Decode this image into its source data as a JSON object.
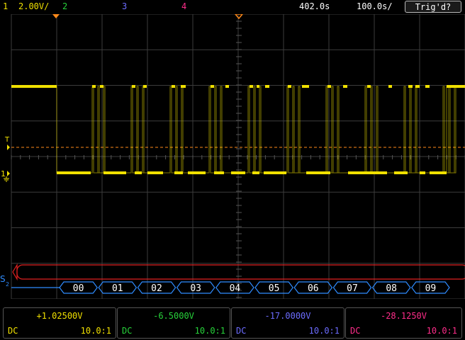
{
  "colors": {
    "ch1": "#f0e000",
    "ch2": "#27d23a",
    "ch3": "#6c6cff",
    "ch4": "#ff2d8a",
    "grid": "#3c3c3c",
    "marker": "#ff8a1a",
    "bus": "#2f8cff",
    "serial_bar": "#e02020"
  },
  "topbar": {
    "ch1_num": "1",
    "ch1_scale": "2.00V/",
    "ch2_num": "2",
    "ch3_num": "3",
    "ch4_num": "4",
    "timebase_pos": "402.0s",
    "timebase_scale": "100.0s/",
    "trigger_status": "Trig'd?"
  },
  "markers": {
    "trigger_level": "T",
    "ch1_ground": "1",
    "serial": "S"
  },
  "bus": {
    "values": [
      "00",
      "01",
      "02",
      "03",
      "04",
      "05",
      "06",
      "07",
      "08",
      "09"
    ]
  },
  "channels": [
    {
      "offset": "+1.02500V",
      "coupling": "DC",
      "probe": "10.0:1"
    },
    {
      "offset": "-6.5000V",
      "coupling": "DC",
      "probe": "10.0:1"
    },
    {
      "offset": "-17.0000V",
      "coupling": "DC",
      "probe": "10.0:1"
    },
    {
      "offset": "-28.1250V",
      "coupling": "DC",
      "probe": "10.0:1"
    }
  ]
}
